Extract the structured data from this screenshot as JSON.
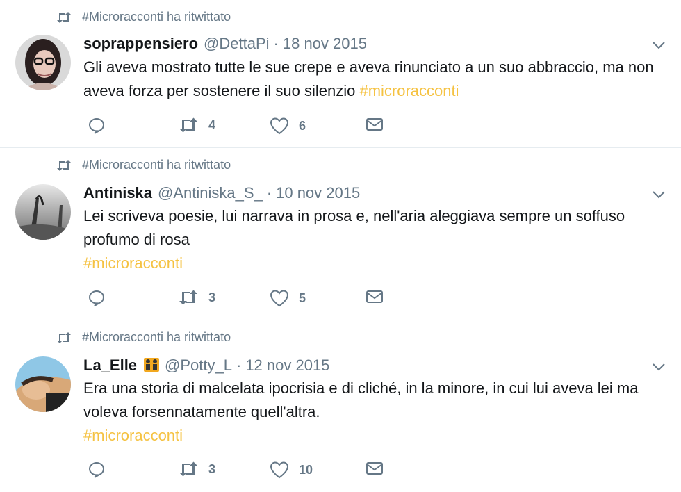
{
  "tweets": [
    {
      "retweet_context": "#Microracconti ha ritwittato",
      "name": "soprappensiero",
      "handle": "@DettaPi",
      "separator": "·",
      "date": "18 nov 2015",
      "text": "Gli aveva mostrato tutte le sue crepe e aveva rinunciato a un suo abbraccio, ma non aveva forza per sostenere il suo silenzio",
      "hashtag": "#microracconti",
      "retweets": "4",
      "likes": "6"
    },
    {
      "retweet_context": "#Microracconti ha ritwittato",
      "name": "Antiniska",
      "handle": "@Antiniska_S_",
      "separator": "·",
      "date": "10 nov 2015",
      "text": "Lei scriveva poesie, lui narrava in prosa e, nell'aria aleggiava sempre un soffuso profumo di rosa",
      "hashtag": "#microracconti",
      "retweets": "3",
      "likes": "5"
    },
    {
      "retweet_context": "#Microracconti ha ritwittato",
      "name": "La_Elle",
      "handle": "@Potty_L",
      "separator": "·",
      "date": "12 nov 2015",
      "text": "Era una storia di malcelata ipocrisia e di cliché, in la minore, in cui lui aveva lei ma voleva forsennatamente quell'altra.",
      "hashtag": "#microracconti",
      "retweets": "3",
      "likes": "10"
    }
  ],
  "colors": {
    "hashtag": "#f5c242",
    "secondary_text": "#657786",
    "divider": "#e6ecf0"
  },
  "icons": [
    "retweet-icon",
    "reply-icon",
    "like-icon",
    "direct-message-icon",
    "chevron-down-icon",
    "dancers-emoji-icon"
  ]
}
